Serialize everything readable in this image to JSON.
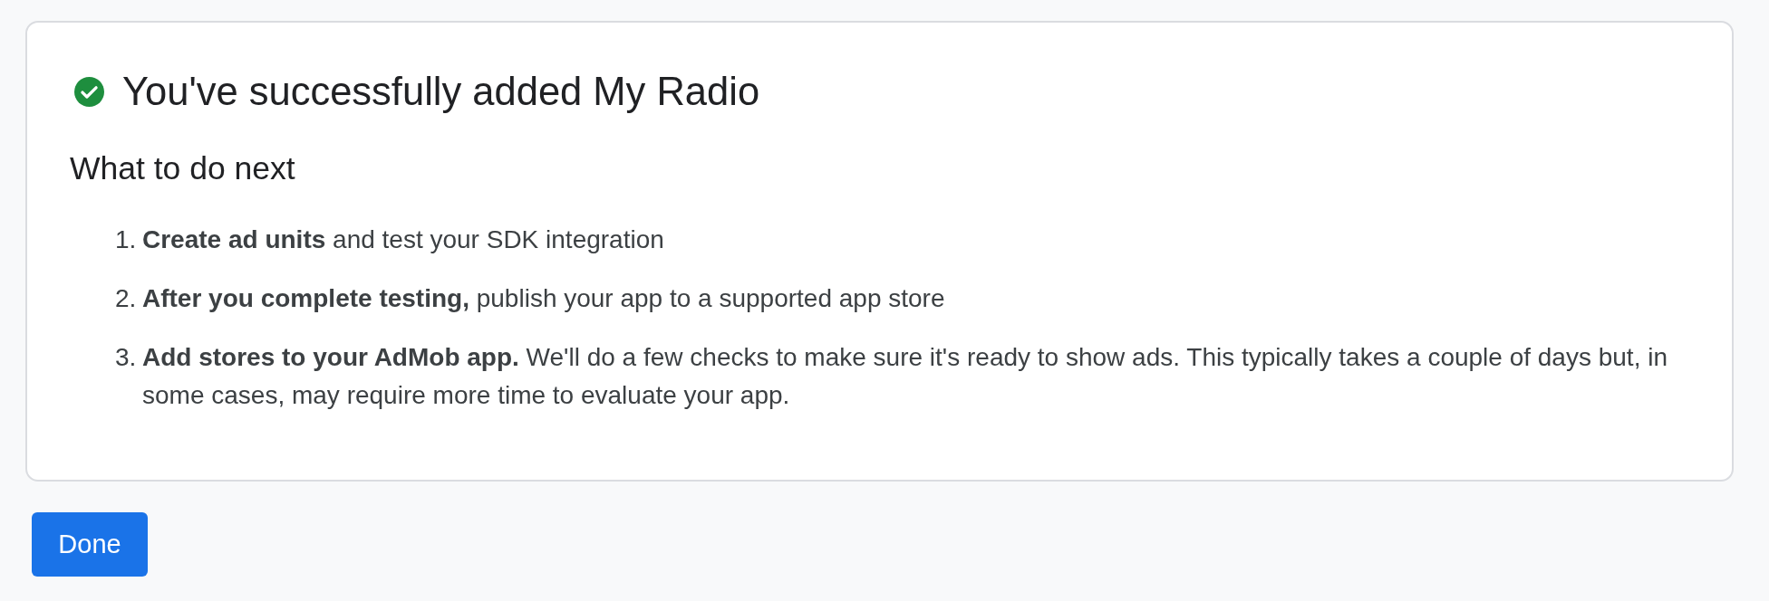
{
  "header": {
    "kind": "success",
    "title": "You've successfully added My Radio"
  },
  "subtitle": "What to do next",
  "steps": [
    {
      "number": "1.",
      "text": "**Create ad units** and test your SDK integration"
    },
    {
      "number": "2.",
      "text": "**After you complete testing,** publish your app to a supported app store"
    },
    {
      "number": "3.",
      "text": "**Add stores to your AdMob app.** We'll do a few checks to make sure it's ready to show ads. This typically takes a couple of days but, in some cases, may require more time to evaluate your app."
    }
  ],
  "buttons": [
    {
      "label": "Done",
      "kind": "primary"
    }
  ]
}
